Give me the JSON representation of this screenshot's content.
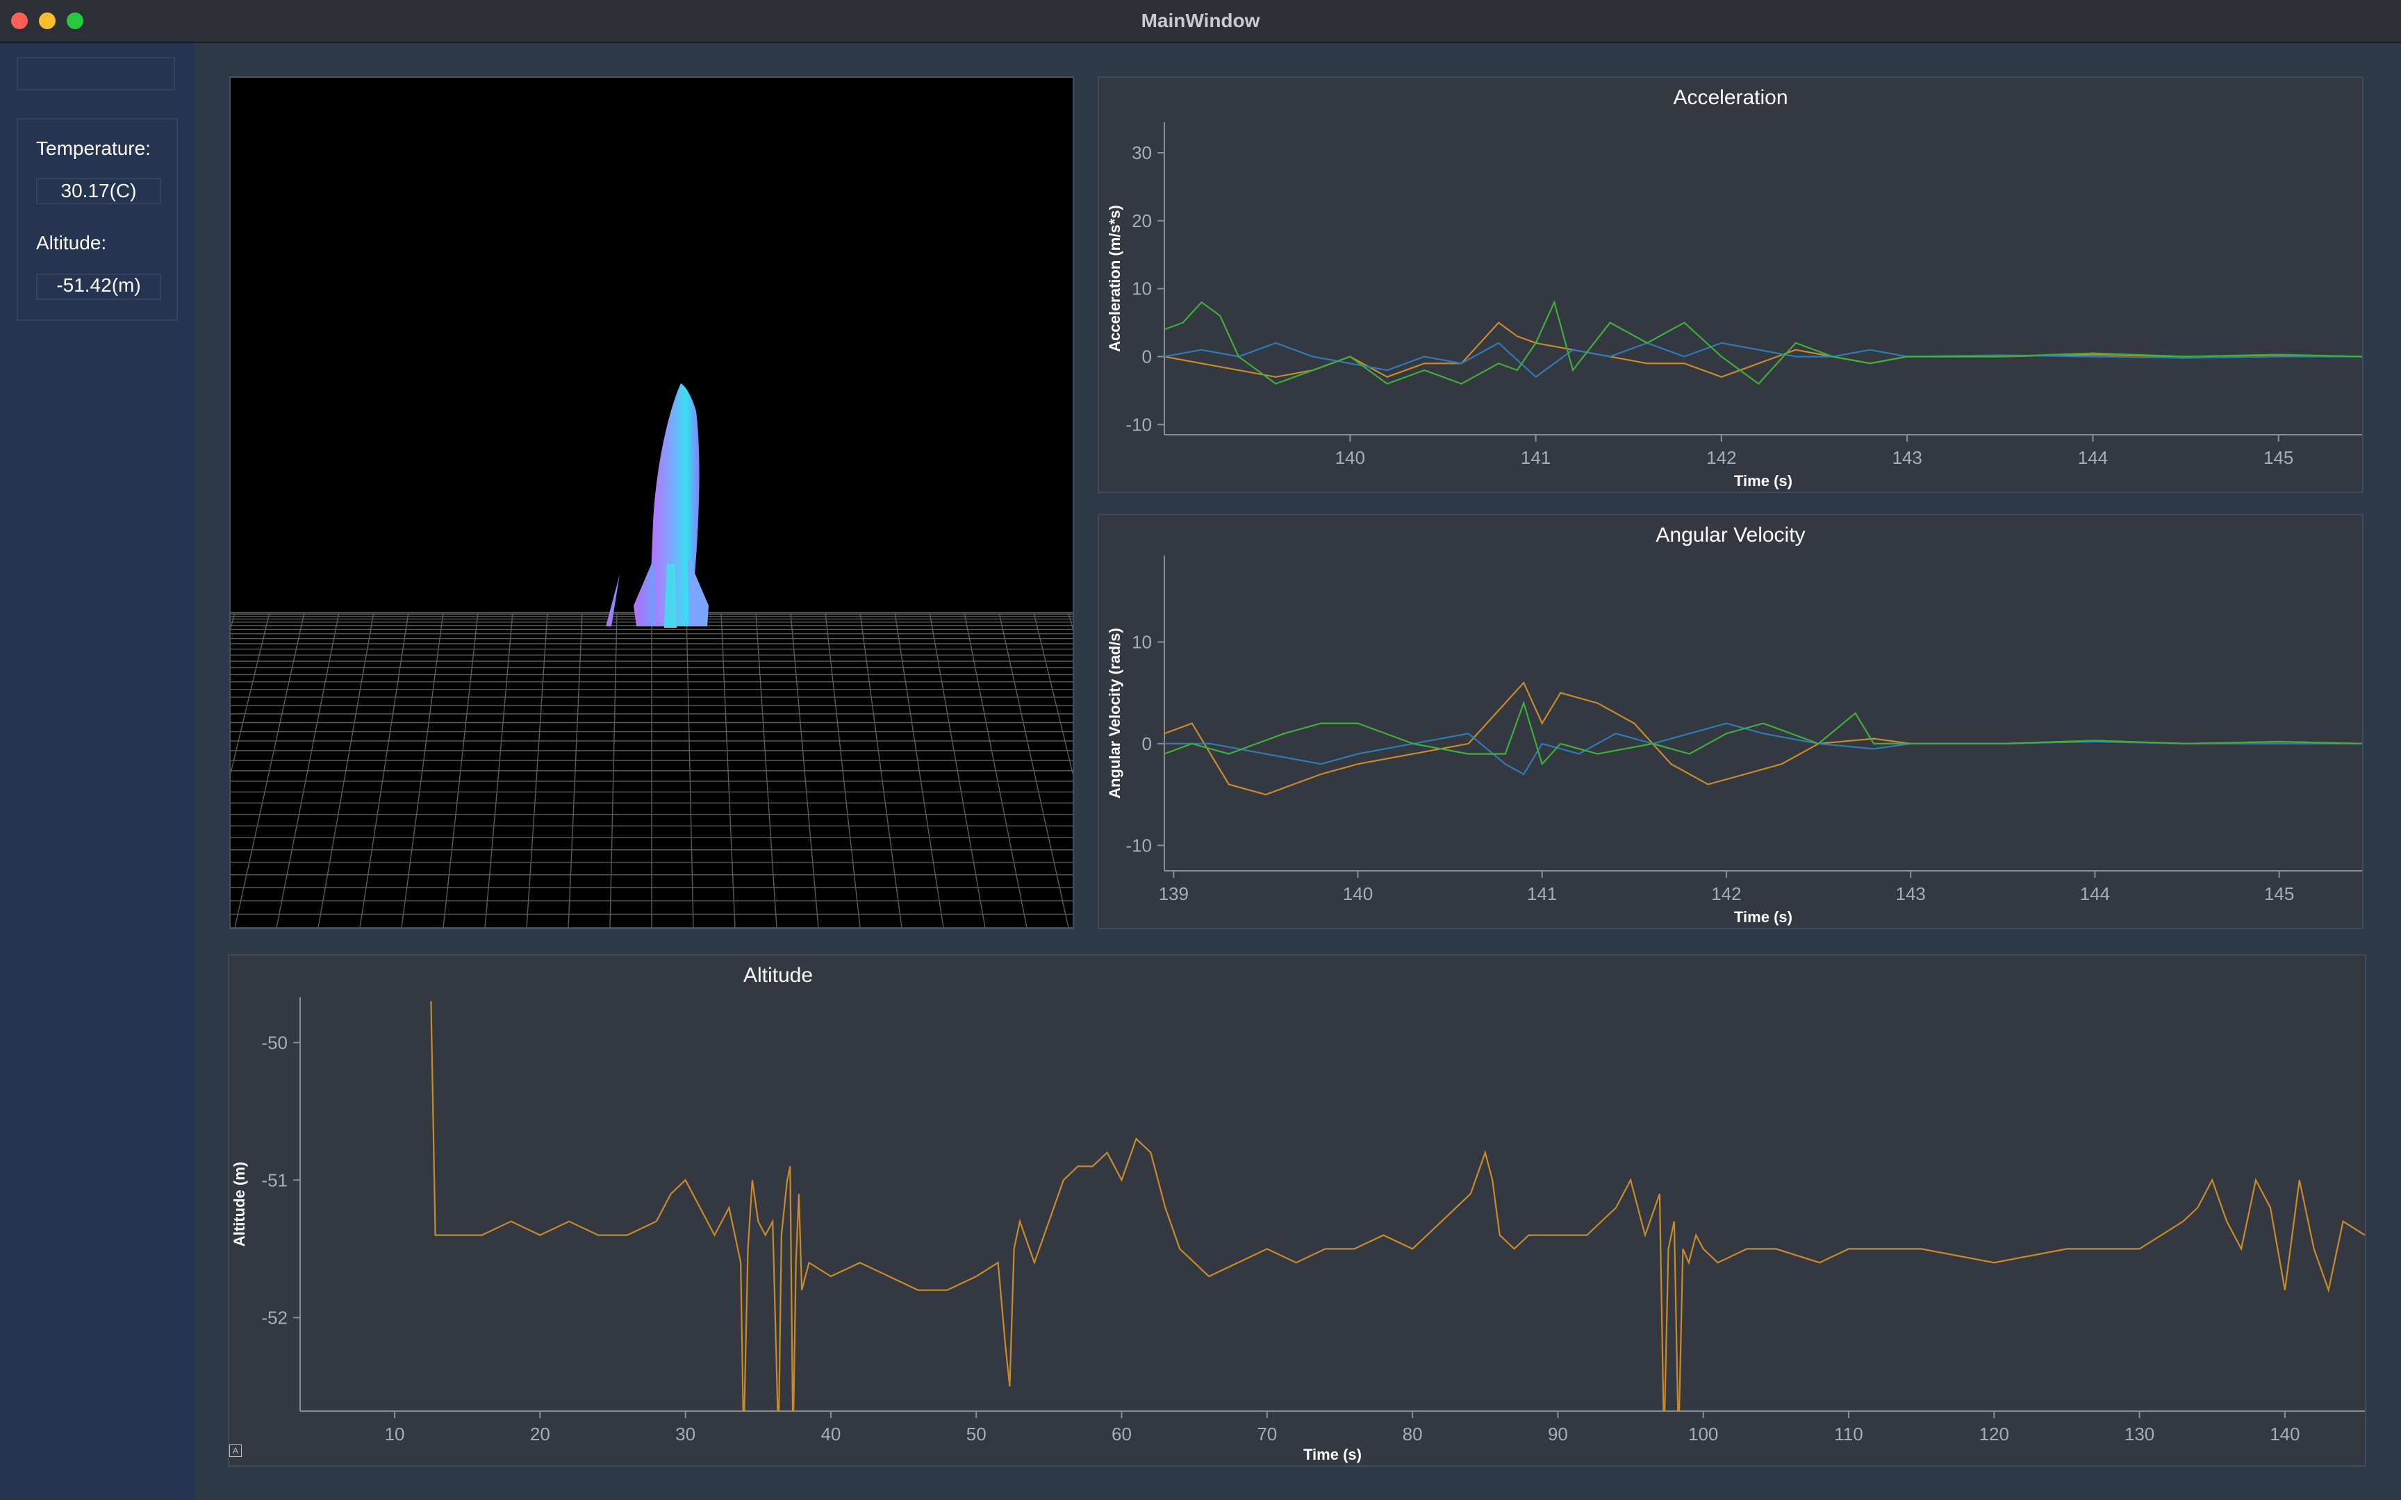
{
  "window": {
    "title": "MainWindow"
  },
  "sidebar": {
    "temperature_label": "Temperature:",
    "temperature_value": "30.17(C)",
    "altitude_label": "Altitude:",
    "altitude_value": "-51.42(m)"
  },
  "viewer": {
    "object": "rocket-model",
    "background": "#000000"
  },
  "colors": {
    "series_orange": "#c98a2a",
    "series_blue": "#2e7bb6",
    "series_green": "#3fae3a"
  },
  "chart_data": [
    {
      "id": "acceleration",
      "type": "line",
      "title": "Acceleration",
      "xlabel": "Time (s)",
      "ylabel": "Acceleration (m/s*s)",
      "xlim": [
        139.0,
        145.45
      ],
      "ylim": [
        -11.5,
        34.5
      ],
      "xticks": [
        140,
        141,
        142,
        143,
        144,
        145
      ],
      "yticks": [
        -10,
        0,
        10,
        20,
        30
      ],
      "series": [
        {
          "color": "#c98a2a",
          "x": [
            139.0,
            139.2,
            139.4,
            139.6,
            139.8,
            140.0,
            140.2,
            140.4,
            140.6,
            140.8,
            140.9,
            141.0,
            141.2,
            141.4,
            141.6,
            141.8,
            142.0,
            142.2,
            142.4,
            142.6,
            142.8,
            143.0,
            143.5,
            144.0,
            144.5,
            145.0,
            145.45
          ],
          "y": [
            0,
            -1,
            -2,
            -3,
            -2,
            0,
            -3,
            -1,
            -1,
            5,
            3,
            2,
            1,
            0,
            -1,
            -1,
            -3,
            -1,
            1,
            0,
            -1,
            0,
            0,
            0.3,
            0,
            0.2,
            0
          ]
        },
        {
          "color": "#2e7bb6",
          "x": [
            139.0,
            139.2,
            139.4,
            139.6,
            139.8,
            140.0,
            140.2,
            140.4,
            140.6,
            140.8,
            141.0,
            141.2,
            141.4,
            141.6,
            141.8,
            142.0,
            142.2,
            142.4,
            142.6,
            142.8,
            143.0,
            143.5,
            144.0,
            144.5,
            145.0,
            145.45
          ],
          "y": [
            0,
            1,
            0,
            2,
            0,
            -1,
            -2,
            0,
            -1,
            2,
            -3,
            1,
            0,
            2,
            0,
            2,
            1,
            0,
            0,
            1,
            0,
            0.2,
            0,
            -0.2,
            0,
            0
          ]
        },
        {
          "color": "#3fae3a",
          "x": [
            139.0,
            139.1,
            139.2,
            139.3,
            139.4,
            139.6,
            139.8,
            140.0,
            140.2,
            140.4,
            140.6,
            140.8,
            140.9,
            141.0,
            141.1,
            141.2,
            141.4,
            141.6,
            141.8,
            142.0,
            142.2,
            142.4,
            142.6,
            142.8,
            143.0,
            143.5,
            144.0,
            144.5,
            145.0,
            145.45
          ],
          "y": [
            4,
            5,
            8,
            6,
            0,
            -4,
            -2,
            0,
            -4,
            -2,
            -4,
            -1,
            -2,
            2,
            8,
            -2,
            5,
            2,
            5,
            0,
            -4,
            2,
            0,
            -1,
            0,
            0,
            0.5,
            0,
            0.3,
            0
          ]
        }
      ]
    },
    {
      "id": "angular_velocity",
      "type": "line",
      "title": "Angular Velocity",
      "xlabel": "Time (s)",
      "ylabel": "Angular Velocity (rad/s)",
      "xlim": [
        138.95,
        145.45
      ],
      "ylim": [
        -12.5,
        18.5
      ],
      "xticks": [
        139,
        140,
        141,
        142,
        143,
        144,
        145
      ],
      "yticks": [
        -10,
        0,
        10
      ],
      "series": [
        {
          "color": "#c98a2a",
          "x": [
            138.95,
            139.1,
            139.3,
            139.5,
            139.8,
            140.0,
            140.3,
            140.6,
            140.8,
            140.9,
            141.0,
            141.1,
            141.3,
            141.5,
            141.7,
            141.9,
            142.1,
            142.3,
            142.5,
            142.8,
            143.0,
            143.5,
            144.0,
            144.5,
            145.0,
            145.45
          ],
          "y": [
            1,
            2,
            -4,
            -5,
            -3,
            -2,
            -1,
            0,
            4,
            6,
            2,
            5,
            4,
            2,
            -2,
            -4,
            -3,
            -2,
            0,
            0.5,
            0,
            0,
            0.3,
            0,
            0.2,
            0
          ]
        },
        {
          "color": "#2e7bb6",
          "x": [
            138.95,
            139.2,
            139.5,
            139.8,
            140.0,
            140.3,
            140.6,
            140.8,
            140.9,
            141.0,
            141.2,
            141.4,
            141.6,
            141.8,
            142.0,
            142.2,
            142.5,
            142.8,
            143.0,
            143.5,
            144.0,
            144.5,
            145.0,
            145.45
          ],
          "y": [
            0,
            0,
            -1,
            -2,
            -1,
            0,
            1,
            -2,
            -3,
            0,
            -1,
            1,
            0,
            1,
            2,
            1,
            0,
            -0.5,
            0,
            0,
            0.2,
            0,
            0,
            0
          ]
        },
        {
          "color": "#3fae3a",
          "x": [
            138.95,
            139.1,
            139.3,
            139.6,
            139.8,
            140.0,
            140.3,
            140.6,
            140.8,
            140.9,
            141.0,
            141.1,
            141.3,
            141.6,
            141.8,
            142.0,
            142.2,
            142.5,
            142.7,
            142.8,
            143.0,
            143.5,
            144.0,
            144.5,
            145.0,
            145.45
          ],
          "y": [
            -1,
            0,
            -1,
            1,
            2,
            2,
            0,
            -1,
            -1,
            4,
            -2,
            0,
            -1,
            0,
            -1,
            1,
            2,
            0,
            3,
            0,
            0,
            0,
            0.3,
            0,
            0.2,
            0
          ]
        }
      ]
    },
    {
      "id": "altitude",
      "type": "line",
      "title": "Altitude",
      "xlabel": "Time (s)",
      "ylabel": "Altitude (m)",
      "xlim": [
        3.5,
        145.5
      ],
      "ylim": [
        -52.68,
        -49.67
      ],
      "xticks": [
        10,
        20,
        30,
        40,
        50,
        60,
        70,
        80,
        90,
        100,
        110,
        120,
        130,
        140
      ],
      "yticks": [
        -52,
        -51,
        -50
      ],
      "series": [
        {
          "color": "#c98a2a",
          "x": [
            12.5,
            12.8,
            14,
            16,
            18,
            20,
            22,
            24,
            26,
            28,
            29,
            30,
            31,
            32,
            33,
            33.8,
            34,
            34.3,
            34.6,
            35,
            35.5,
            36,
            36.4,
            36.6,
            37,
            37.2,
            37.4,
            37.6,
            37.8,
            38,
            38.5,
            40,
            42,
            44,
            46,
            48,
            50,
            51.5,
            52,
            52.3,
            52.6,
            53,
            54,
            55,
            56,
            57,
            58,
            59,
            60,
            61,
            62,
            63,
            64,
            65,
            66,
            68,
            70,
            72,
            74,
            76,
            78,
            80,
            82,
            84,
            85,
            85.5,
            86,
            87,
            88,
            90,
            92,
            94,
            95,
            95.5,
            96,
            97,
            97.3,
            97.6,
            98,
            98.3,
            98.6,
            99,
            99.5,
            100,
            101,
            103,
            105,
            108,
            110,
            115,
            120,
            125,
            130,
            133,
            134,
            135,
            136,
            137,
            138,
            139,
            140,
            141,
            142,
            143,
            144,
            145.5
          ],
          "y": [
            -49.7,
            -51.4,
            -51.4,
            -51.4,
            -51.3,
            -51.4,
            -51.3,
            -51.4,
            -51.4,
            -51.3,
            -51.1,
            -51.0,
            -51.2,
            -51.4,
            -51.2,
            -51.6,
            -52.9,
            -51.5,
            -51.0,
            -51.3,
            -51.4,
            -51.3,
            -52.9,
            -51.4,
            -51.0,
            -50.9,
            -52.9,
            -51.6,
            -51.1,
            -51.8,
            -51.6,
            -51.7,
            -51.6,
            -51.7,
            -51.8,
            -51.8,
            -51.7,
            -51.6,
            -52.2,
            -52.5,
            -51.5,
            -51.3,
            -51.6,
            -51.3,
            -51.0,
            -50.9,
            -50.9,
            -50.8,
            -51.0,
            -50.7,
            -50.8,
            -51.2,
            -51.5,
            -51.6,
            -51.7,
            -51.6,
            -51.5,
            -51.6,
            -51.5,
            -51.5,
            -51.4,
            -51.5,
            -51.3,
            -51.1,
            -50.8,
            -51.0,
            -51.4,
            -51.5,
            -51.4,
            -51.4,
            -51.4,
            -51.2,
            -51.0,
            -51.2,
            -51.4,
            -51.1,
            -52.9,
            -51.5,
            -51.3,
            -52.9,
            -51.5,
            -51.6,
            -51.4,
            -51.5,
            -51.6,
            -51.5,
            -51.5,
            -51.6,
            -51.5,
            -51.5,
            -51.6,
            -51.5,
            -51.5,
            -51.3,
            -51.2,
            -51.0,
            -51.3,
            -51.5,
            -51.0,
            -51.2,
            -51.8,
            -51.0,
            -51.5,
            -51.8,
            -51.3,
            -51.4
          ]
        }
      ]
    }
  ]
}
